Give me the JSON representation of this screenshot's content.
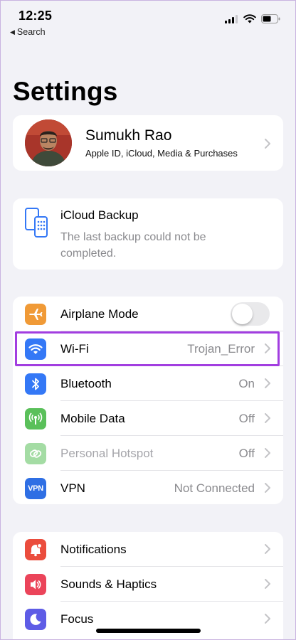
{
  "status_bar": {
    "time": "12:25",
    "back_label": "Search"
  },
  "page": {
    "title": "Settings"
  },
  "profile": {
    "name": "Sumukh Rao",
    "subtitle": "Apple ID, iCloud, Media & Purchases"
  },
  "backup": {
    "title": "iCloud Backup",
    "message": "The last backup could not be completed."
  },
  "connectivity": [
    {
      "label": "Airplane Mode",
      "value": "",
      "icon": "airplane-icon",
      "color": "#f09a37",
      "toggle_on": false
    },
    {
      "label": "Wi-Fi",
      "value": "Trojan_Error",
      "icon": "wifi-icon",
      "color": "#3478f6"
    },
    {
      "label": "Bluetooth",
      "value": "On",
      "icon": "bluetooth-icon",
      "color": "#3478f6"
    },
    {
      "label": "Mobile Data",
      "value": "Off",
      "icon": "antenna-icon",
      "color": "#5ac05a"
    },
    {
      "label": "Personal Hotspot",
      "value": "Off",
      "icon": "link-icon",
      "color": "#5ac05a",
      "disabled": true
    },
    {
      "label": "VPN",
      "value": "Not Connected",
      "icon": "vpn-icon",
      "icon_text": "VPN",
      "color": "#2f6fe4"
    }
  ],
  "general": [
    {
      "label": "Notifications",
      "icon": "bell-icon",
      "color": "#eb4d3d"
    },
    {
      "label": "Sounds & Haptics",
      "icon": "speaker-icon",
      "color": "#eb445a"
    },
    {
      "label": "Focus",
      "icon": "moon-icon",
      "color": "#5e5ce6"
    }
  ],
  "highlight_color": "#a23ee0"
}
